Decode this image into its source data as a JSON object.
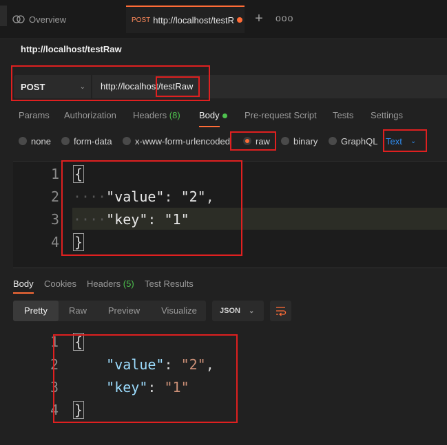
{
  "tabs": {
    "overview": "Overview",
    "active_method": "POST",
    "active_url": "http://localhost/testRaw",
    "more": "ooo"
  },
  "request": {
    "title": "http://localhost/testRaw",
    "method": "POST",
    "url_prefix": "http://localhost/",
    "url_path": "testRaw"
  },
  "request_tabs": {
    "params": "Params",
    "authorization": "Authorization",
    "headers": "Headers",
    "headers_count": "(8)",
    "body": "Body",
    "prerequest": "Pre-request Script",
    "tests": "Tests",
    "settings": "Settings"
  },
  "body_types": {
    "none": "none",
    "form_data": "form-data",
    "urlencoded": "x-www-form-urlencoded",
    "raw": "raw",
    "binary": "binary",
    "graphql": "GraphQL",
    "selected": "raw",
    "format": "Text"
  },
  "request_body": {
    "line_numbers": [
      "1",
      "2",
      "3",
      "4"
    ],
    "open": "{",
    "key1": "\"value\"",
    "val1": "\"2\"",
    "key2": "\"key\"",
    "val2": "\"1\"",
    "close": "}"
  },
  "response_tabs": {
    "body": "Body",
    "cookies": "Cookies",
    "headers": "Headers",
    "headers_count": "(5)",
    "test_results": "Test Results"
  },
  "response_view": {
    "pretty": "Pretty",
    "raw": "Raw",
    "preview": "Preview",
    "visualize": "Visualize",
    "language": "JSON"
  },
  "response_body": {
    "line_numbers": [
      "1",
      "2",
      "3",
      "4"
    ],
    "open": "{",
    "key1": "\"value\"",
    "val1": "\"2\"",
    "key2": "\"key\"",
    "val2": "\"1\"",
    "close": "}"
  },
  "colors": {
    "accent": "#ff6c37",
    "annotation": "#e02020",
    "link_blue": "#2f8cf0",
    "green": "#4ec24e"
  }
}
